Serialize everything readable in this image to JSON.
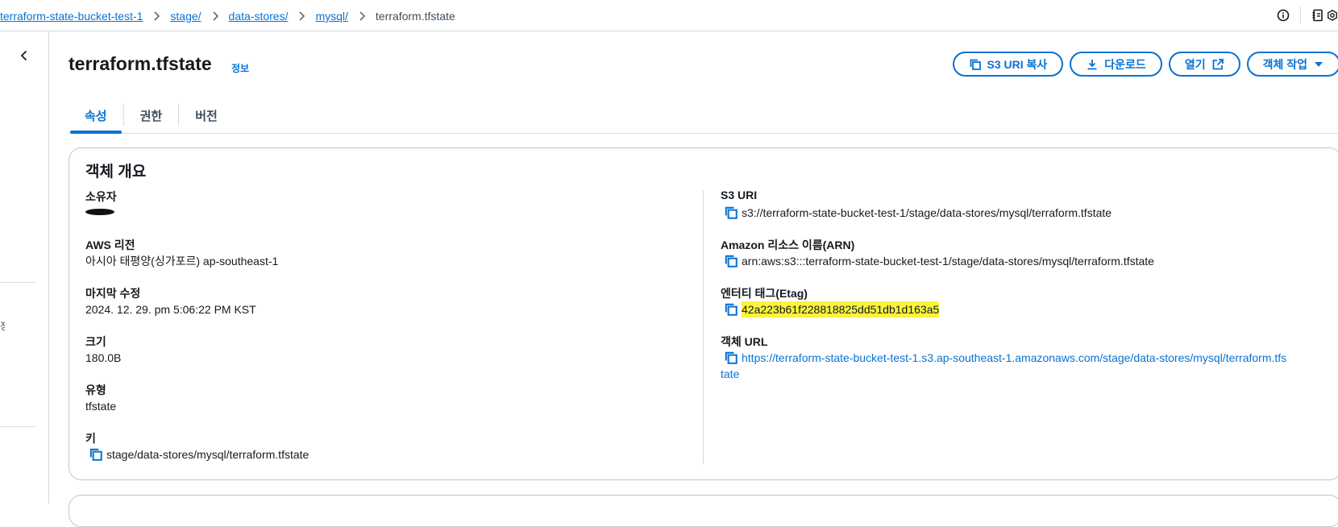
{
  "breadcrumb": {
    "items": [
      "terraform-state-bucket-test-1",
      "stage/",
      "data-stores/",
      "mysql/"
    ],
    "current": "terraform.tfstate"
  },
  "nav": {
    "fragment": "정"
  },
  "header": {
    "title": "terraform.tfstate",
    "info_label": "정보",
    "buttons": {
      "copy_uri": "S3 URI 복사",
      "download": "다운로드",
      "open": "열기",
      "actions": "객체 작업"
    }
  },
  "tabs": [
    {
      "label": "속성",
      "active": true
    },
    {
      "label": "권한",
      "active": false
    },
    {
      "label": "버전",
      "active": false
    }
  ],
  "overview": {
    "title": "객체 개요",
    "owner": {
      "label": "소유자",
      "value": ""
    },
    "region": {
      "label": "AWS 리전",
      "value": "아시아 태평양(싱가포르) ap-southeast-1"
    },
    "modified": {
      "label": "마지막 수정",
      "value": "2024. 12. 29. pm 5:06:22 PM KST"
    },
    "size": {
      "label": "크기",
      "value": "180.0B"
    },
    "type": {
      "label": "유형",
      "value": "tfstate"
    },
    "key": {
      "label": "키",
      "value": "stage/data-stores/mysql/terraform.tfstate"
    },
    "s3_uri": {
      "label": "S3 URI",
      "value": "s3://terraform-state-bucket-test-1/stage/data-stores/mysql/terraform.tfstate"
    },
    "arn": {
      "label": "Amazon 리소스 이름(ARN)",
      "value": "arn:aws:s3:::terraform-state-bucket-test-1/stage/data-stores/mysql/terraform.tfstate"
    },
    "etag": {
      "label": "엔터티 태그(Etag)",
      "value": "42a223b61f228818825dd51db1d163a5"
    },
    "url": {
      "label": "객체 URL",
      "line1": "https://terraform-state-bucket-test-1.s3.ap-southeast-1.amazonaws.com/stage/data-stores/mysql/terraform.tfs",
      "line2": "tate"
    }
  },
  "colors": {
    "accent": "#0972d3",
    "highlight": "#f9f43c",
    "border": "#d5dbdb"
  }
}
